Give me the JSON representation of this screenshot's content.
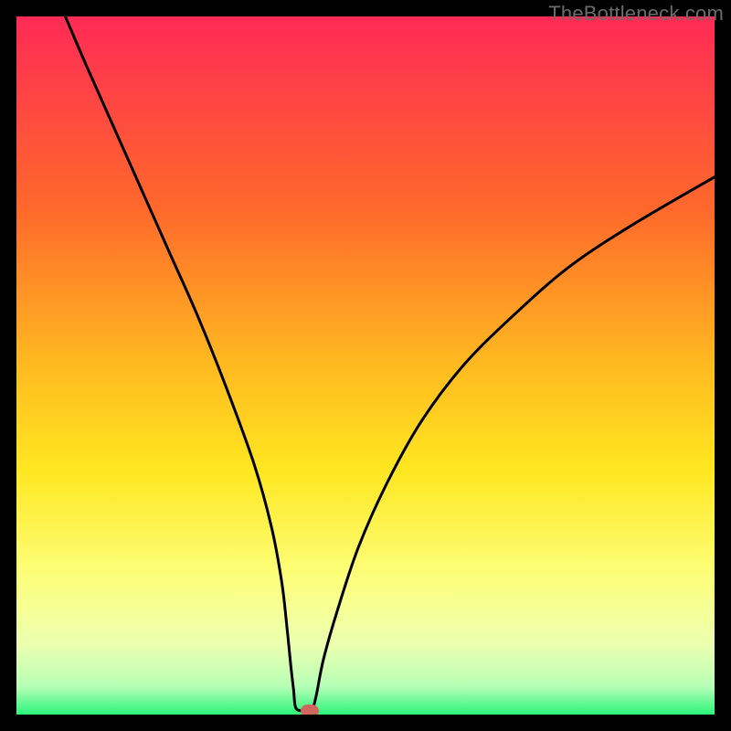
{
  "watermark": "TheBottleneck.com",
  "chart_data": {
    "type": "line",
    "title": "",
    "xlabel": "",
    "ylabel": "",
    "xlim": [
      0,
      100
    ],
    "ylim": [
      0,
      100
    ],
    "gradient_stops": [
      {
        "offset": 0,
        "color": "#ff2a55"
      },
      {
        "offset": 28,
        "color": "#ff6a2b"
      },
      {
        "offset": 50,
        "color": "#ffba20"
      },
      {
        "offset": 65,
        "color": "#ffe720"
      },
      {
        "offset": 80,
        "color": "#fdff7a"
      },
      {
        "offset": 90,
        "color": "#ecffb0"
      },
      {
        "offset": 96,
        "color": "#b6ffb6"
      },
      {
        "offset": 100,
        "color": "#2cf57a"
      }
    ],
    "series": [
      {
        "name": "bottleneck-curve",
        "x": [
          7,
          10,
          14,
          18,
          22,
          26,
          30,
          34,
          36.5,
          38,
          38.8,
          39.3,
          39.7,
          40,
          41,
          42,
          42.5,
          43,
          44,
          46,
          49,
          53,
          58,
          64,
          71,
          79,
          88,
          100
        ],
        "values": [
          100,
          93,
          84,
          75,
          66,
          57,
          47,
          36,
          27,
          19,
          12,
          7,
          3.5,
          1,
          0.5,
          0.5,
          1,
          3,
          8,
          15,
          24,
          33,
          42,
          50,
          57,
          64,
          70,
          77
        ]
      }
    ],
    "marker": {
      "x": 42,
      "y": 0.5,
      "color": "#d1665f"
    }
  }
}
